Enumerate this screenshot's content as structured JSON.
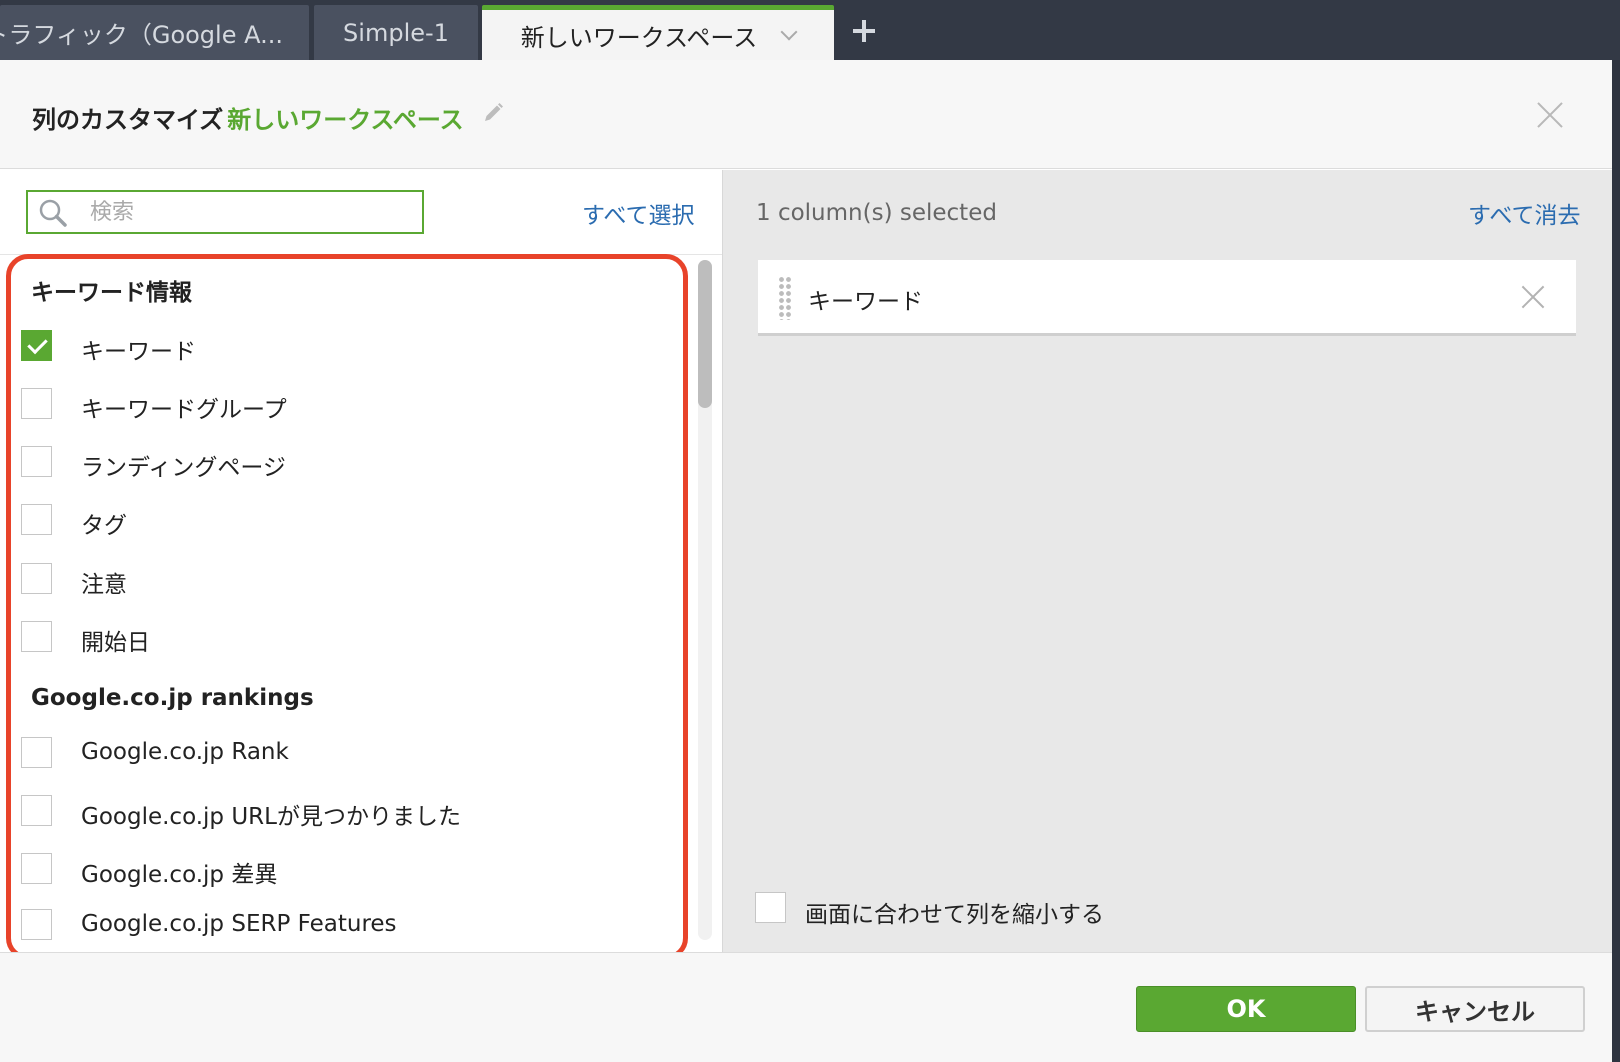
{
  "tabs": [
    {
      "label": "トラフィック（Google A..."
    },
    {
      "label": "Simple-1"
    },
    {
      "label": "新しいワークスペース"
    }
  ],
  "dialog": {
    "title": "列のカスタマイズ",
    "workspace_name": "新しいワークスペース"
  },
  "left_panel": {
    "search_placeholder": "検索",
    "select_all": "すべて選択",
    "groups": [
      {
        "heading": "キーワード情報",
        "items": [
          {
            "label": "キーワード",
            "checked": true
          },
          {
            "label": "キーワードグループ",
            "checked": false
          },
          {
            "label": "ランディングページ",
            "checked": false
          },
          {
            "label": "タグ",
            "checked": false
          },
          {
            "label": "注意",
            "checked": false
          },
          {
            "label": "開始日",
            "checked": false
          }
        ]
      },
      {
        "heading": "Google.co.jp rankings",
        "items": [
          {
            "label": "Google.co.jp Rank",
            "checked": false
          },
          {
            "label": "Google.co.jp URLが見つかりました",
            "checked": false
          },
          {
            "label": "Google.co.jp 差異",
            "checked": false
          },
          {
            "label": "Google.co.jp SERP Features",
            "checked": false
          }
        ]
      }
    ]
  },
  "right_panel": {
    "selected_count": "1 column(s) selected",
    "clear_all": "すべて消去",
    "selected_columns": [
      {
        "label": "キーワード"
      }
    ],
    "shrink_label": "画面に合わせて列を縮小する"
  },
  "footer": {
    "ok_label": "OK",
    "cancel_label": "キャンセル"
  },
  "colors": {
    "accent_green": "#5aa832",
    "link_blue": "#2b6cb0",
    "highlight_red": "#e8432a",
    "tabbar_bg": "#333945"
  },
  "icons": {
    "edit": "pencil-icon",
    "close": "close-icon",
    "search": "search-icon",
    "dropdown": "chevron-down-icon",
    "add_tab": "plus-icon",
    "drag": "drag-handle-icon"
  }
}
